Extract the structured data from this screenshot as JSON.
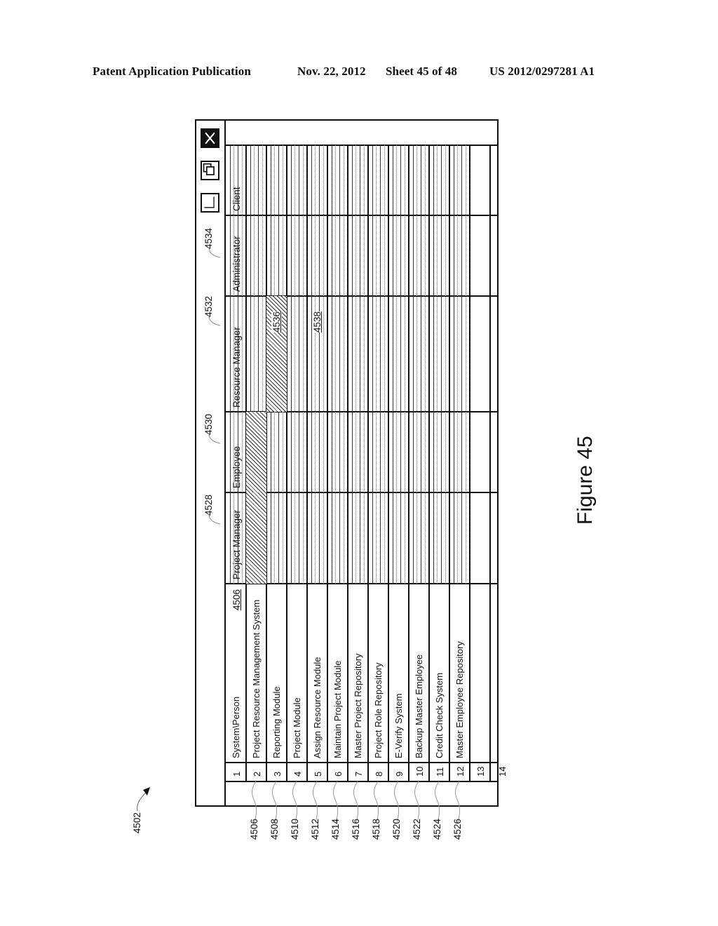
{
  "header": {
    "publication": "Patent Application Publication",
    "date": "Nov. 22, 2012",
    "sheet": "Sheet 45 of 48",
    "number": "US 2012/0297281 A1"
  },
  "figure": {
    "label": "Figure 45",
    "ref": "4502"
  },
  "window": {
    "buttons": {
      "close": "close-icon",
      "restore": "restore-icon",
      "maximize": "maximize-icon"
    },
    "corner_header": "System\\Person",
    "corner_ref": "4506",
    "columns": [
      {
        "label": "Project Manager",
        "ref": "4528"
      },
      {
        "label": "Employee",
        "ref": "4530"
      },
      {
        "label": "Resource Manager",
        "ref": "4532"
      },
      {
        "label": "Administrator",
        "ref": "4534"
      },
      {
        "label": "Client",
        "ref": ""
      }
    ],
    "rows": [
      {
        "num": "1",
        "label": "System\\Person",
        "ref": "4506"
      },
      {
        "num": "2",
        "label": "Project Resource Management System",
        "ref": "4506"
      },
      {
        "num": "3",
        "label": "Reporting Module",
        "ref": "4508"
      },
      {
        "num": "4",
        "label": "Project Module",
        "ref": "4510"
      },
      {
        "num": "5",
        "label": "Assign Resource Module",
        "ref": "4512"
      },
      {
        "num": "6",
        "label": "Maintain Project Module",
        "ref": "4514"
      },
      {
        "num": "7",
        "label": "Master Project Repository",
        "ref": "4516"
      },
      {
        "num": "8",
        "label": "Project Role Repository",
        "ref": "4518"
      },
      {
        "num": "9",
        "label": "E-Verify System",
        "ref": "4520"
      },
      {
        "num": "10",
        "label": "Backup Master Employee",
        "ref": "4522"
      },
      {
        "num": "11",
        "label": "Credit Check System",
        "ref": "4524"
      },
      {
        "num": "12",
        "label": "Master Employee Repository",
        "ref": "4526"
      },
      {
        "num": "13",
        "label": "",
        "ref": ""
      },
      {
        "num": "14",
        "label": "",
        "ref": ""
      }
    ],
    "row_refs": [
      "4506",
      "4508",
      "4510",
      "4512",
      "4514",
      "4516",
      "4518",
      "4520",
      "4522",
      "4524",
      "4526"
    ],
    "highlighted_cells": [
      {
        "row": "2",
        "column": "Project Manager"
      },
      {
        "row": "2",
        "column": "Employee"
      },
      {
        "row": "3",
        "column": "Resource Manager",
        "ref": "4536"
      }
    ],
    "cell_annotation": {
      "row": "5",
      "column": "Resource Manager",
      "ref": "4538"
    }
  }
}
